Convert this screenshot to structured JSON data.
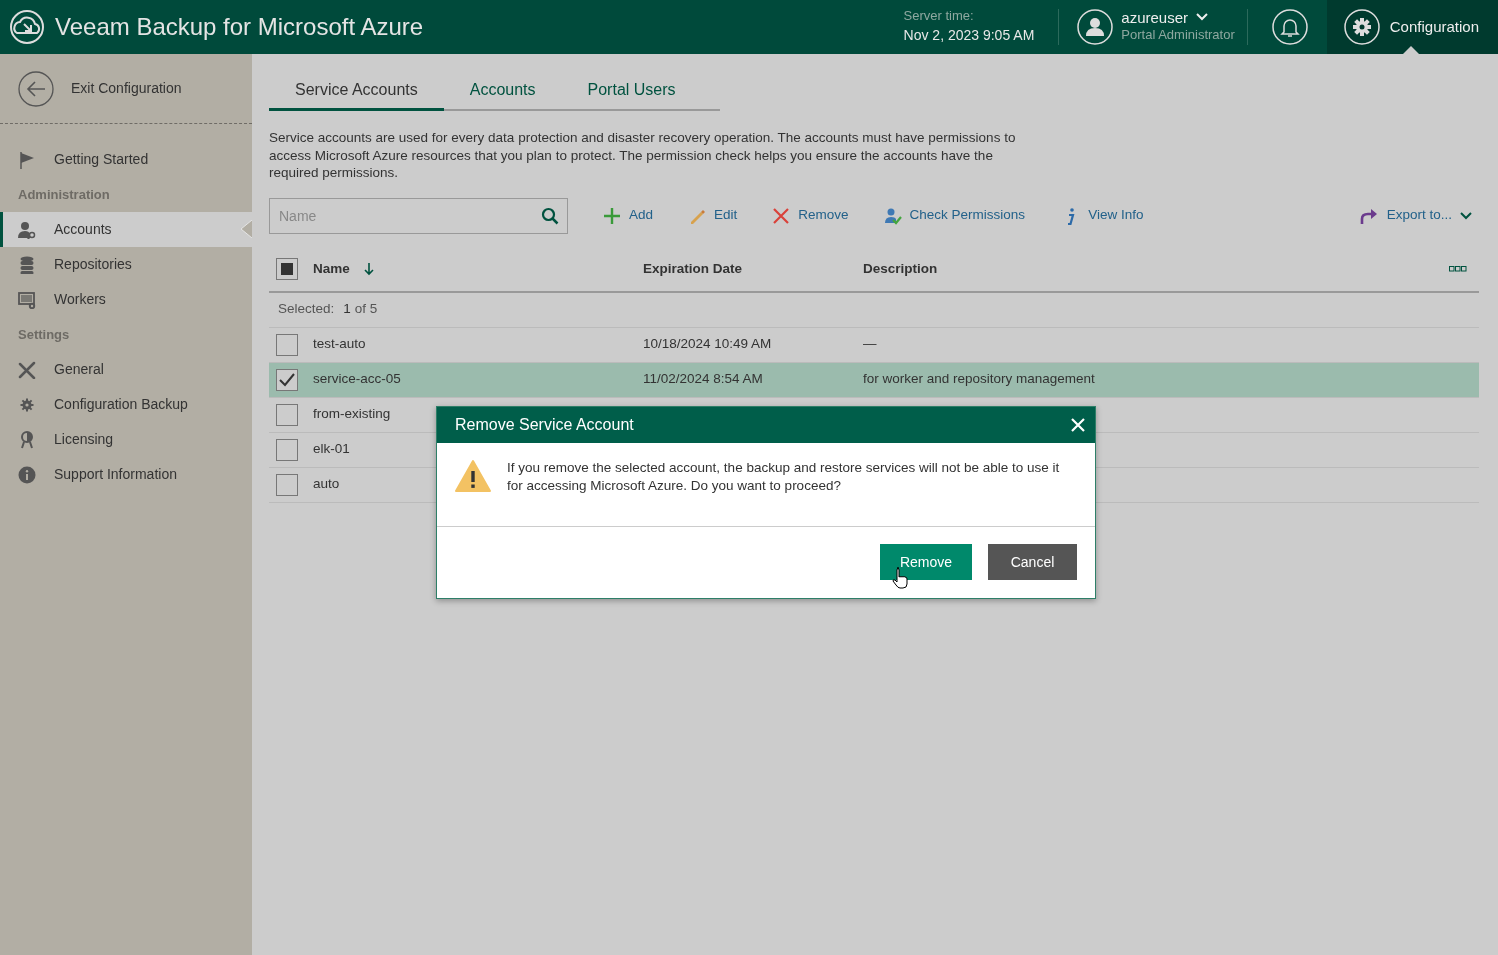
{
  "app": {
    "title": "Veeam Backup for Microsoft Azure"
  },
  "header": {
    "server_time_label": "Server time:",
    "server_time": "Nov 2, 2023 9:05 AM",
    "user": {
      "name": "azureuser",
      "role": "Portal Administrator"
    },
    "configuration": {
      "label": "Configuration",
      "selected": true
    }
  },
  "sidebar": {
    "exit": "Exit Configuration",
    "items": [
      {
        "kind": "item",
        "label": "Getting Started",
        "selected": false
      },
      {
        "kind": "heading",
        "label": "Administration"
      },
      {
        "kind": "item",
        "label": "Accounts",
        "selected": true
      },
      {
        "kind": "item",
        "label": "Repositories",
        "selected": false
      },
      {
        "kind": "item",
        "label": "Workers",
        "selected": false
      },
      {
        "kind": "heading",
        "label": "Settings"
      },
      {
        "kind": "item",
        "label": "General",
        "selected": false
      },
      {
        "kind": "item",
        "label": "Configuration Backup",
        "selected": false
      },
      {
        "kind": "item",
        "label": "Licensing",
        "selected": false
      },
      {
        "kind": "item",
        "label": "Support Information",
        "selected": false
      }
    ]
  },
  "tabs": [
    {
      "label": "Service Accounts",
      "selected": true
    },
    {
      "label": "Accounts",
      "selected": false
    },
    {
      "label": "Portal Users",
      "selected": false
    }
  ],
  "description": "Service accounts are used for every data protection and disaster recovery operation. The accounts must have permissions to access Microsoft Azure resources that you plan to protect. The permission check helps you ensure the accounts have the required permissions.",
  "search": {
    "placeholder": "Name"
  },
  "toolbar": [
    {
      "label": "Add"
    },
    {
      "label": "Edit"
    },
    {
      "label": "Remove"
    },
    {
      "label": "Check Permissions"
    },
    {
      "label": "View Info"
    }
  ],
  "export": {
    "label": "Export to..."
  },
  "table": {
    "header_checkbox": {
      "partial": true
    },
    "columns": [
      {
        "label": "Name",
        "sorted": true
      },
      {
        "label": "Expiration Date"
      },
      {
        "label": "Description"
      }
    ],
    "selection": {
      "label": "Selected:",
      "count": "1",
      "total": "of 5"
    },
    "rows": [
      {
        "name": "test-auto",
        "expiration": "10/18/2024 10:49 AM",
        "description": "—",
        "selected": false
      },
      {
        "name": "service-acc-05",
        "expiration": "11/02/2024 8:54 AM",
        "description": "for worker and repository management",
        "selected": true
      },
      {
        "name": "from-existing",
        "selected": false
      },
      {
        "name": "elk-01",
        "selected": false
      },
      {
        "name": "auto",
        "selected": false
      }
    ]
  },
  "dialog": {
    "title": "Remove Service Account",
    "message": "If you remove the selected account, the backup and restore services will not be able to use it for accessing Microsoft Azure. Do you want to proceed?",
    "buttons": [
      {
        "label": "Remove",
        "kind": "primary"
      },
      {
        "label": "Cancel",
        "kind": "secondary"
      }
    ]
  }
}
